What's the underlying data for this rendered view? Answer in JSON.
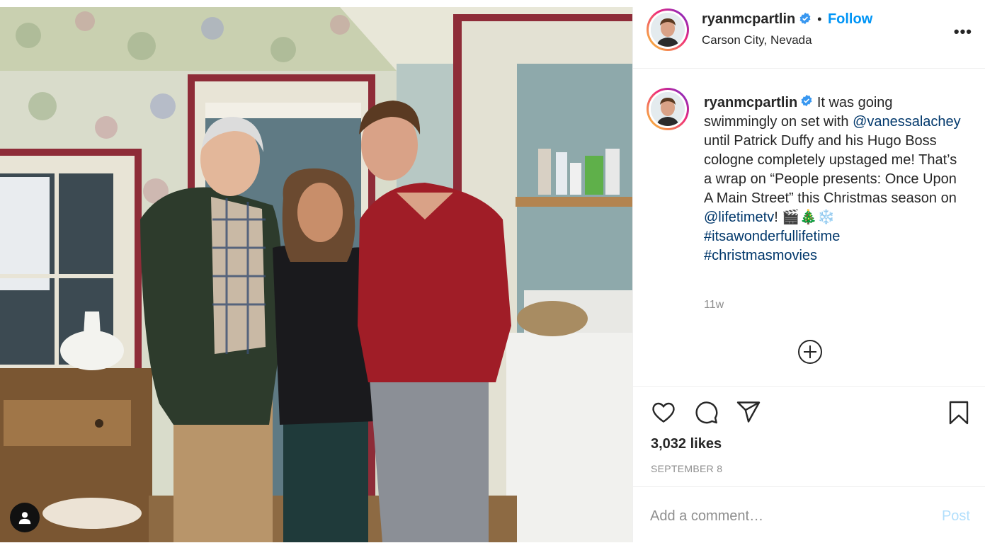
{
  "post": {
    "username": "ryanmcpartlin",
    "follow_label": "Follow",
    "separator": "•",
    "location": "Carson City, Nevada",
    "more_label": "•••",
    "caption": {
      "username": "ryanmcpartlin",
      "text_1": " It was going swimmingly on set with ",
      "mention_1": "@vanessalachey",
      "text_2": " until Patrick Duffy and his Hugo Boss cologne completely upstaged me! That’s a wrap on “People presents: Once Upon A Main Street” this Christmas season on ",
      "mention_2": "@lifetimetv",
      "text_3": "! 🎬🎄❄️ ",
      "hashtag_1": "#itsawonderfullifetime",
      "hashtag_2": "#christmasmovies"
    },
    "time_ago": "11w",
    "likes": "3,032 likes",
    "date": "SEPTEMBER 8",
    "comment_placeholder": "Add a comment…",
    "post_label": "Post"
  },
  "icons": {
    "verified": "verified-badge-icon",
    "like": "heart-icon",
    "comment": "comment-icon",
    "share": "paper-plane-icon",
    "save": "bookmark-icon",
    "load_more": "plus-circle-icon",
    "tag": "user-tag-icon"
  },
  "colors": {
    "accent": "#0095f6",
    "link": "#00376b",
    "muted": "#8e8e8e",
    "post_disabled": "#b2dffc"
  }
}
